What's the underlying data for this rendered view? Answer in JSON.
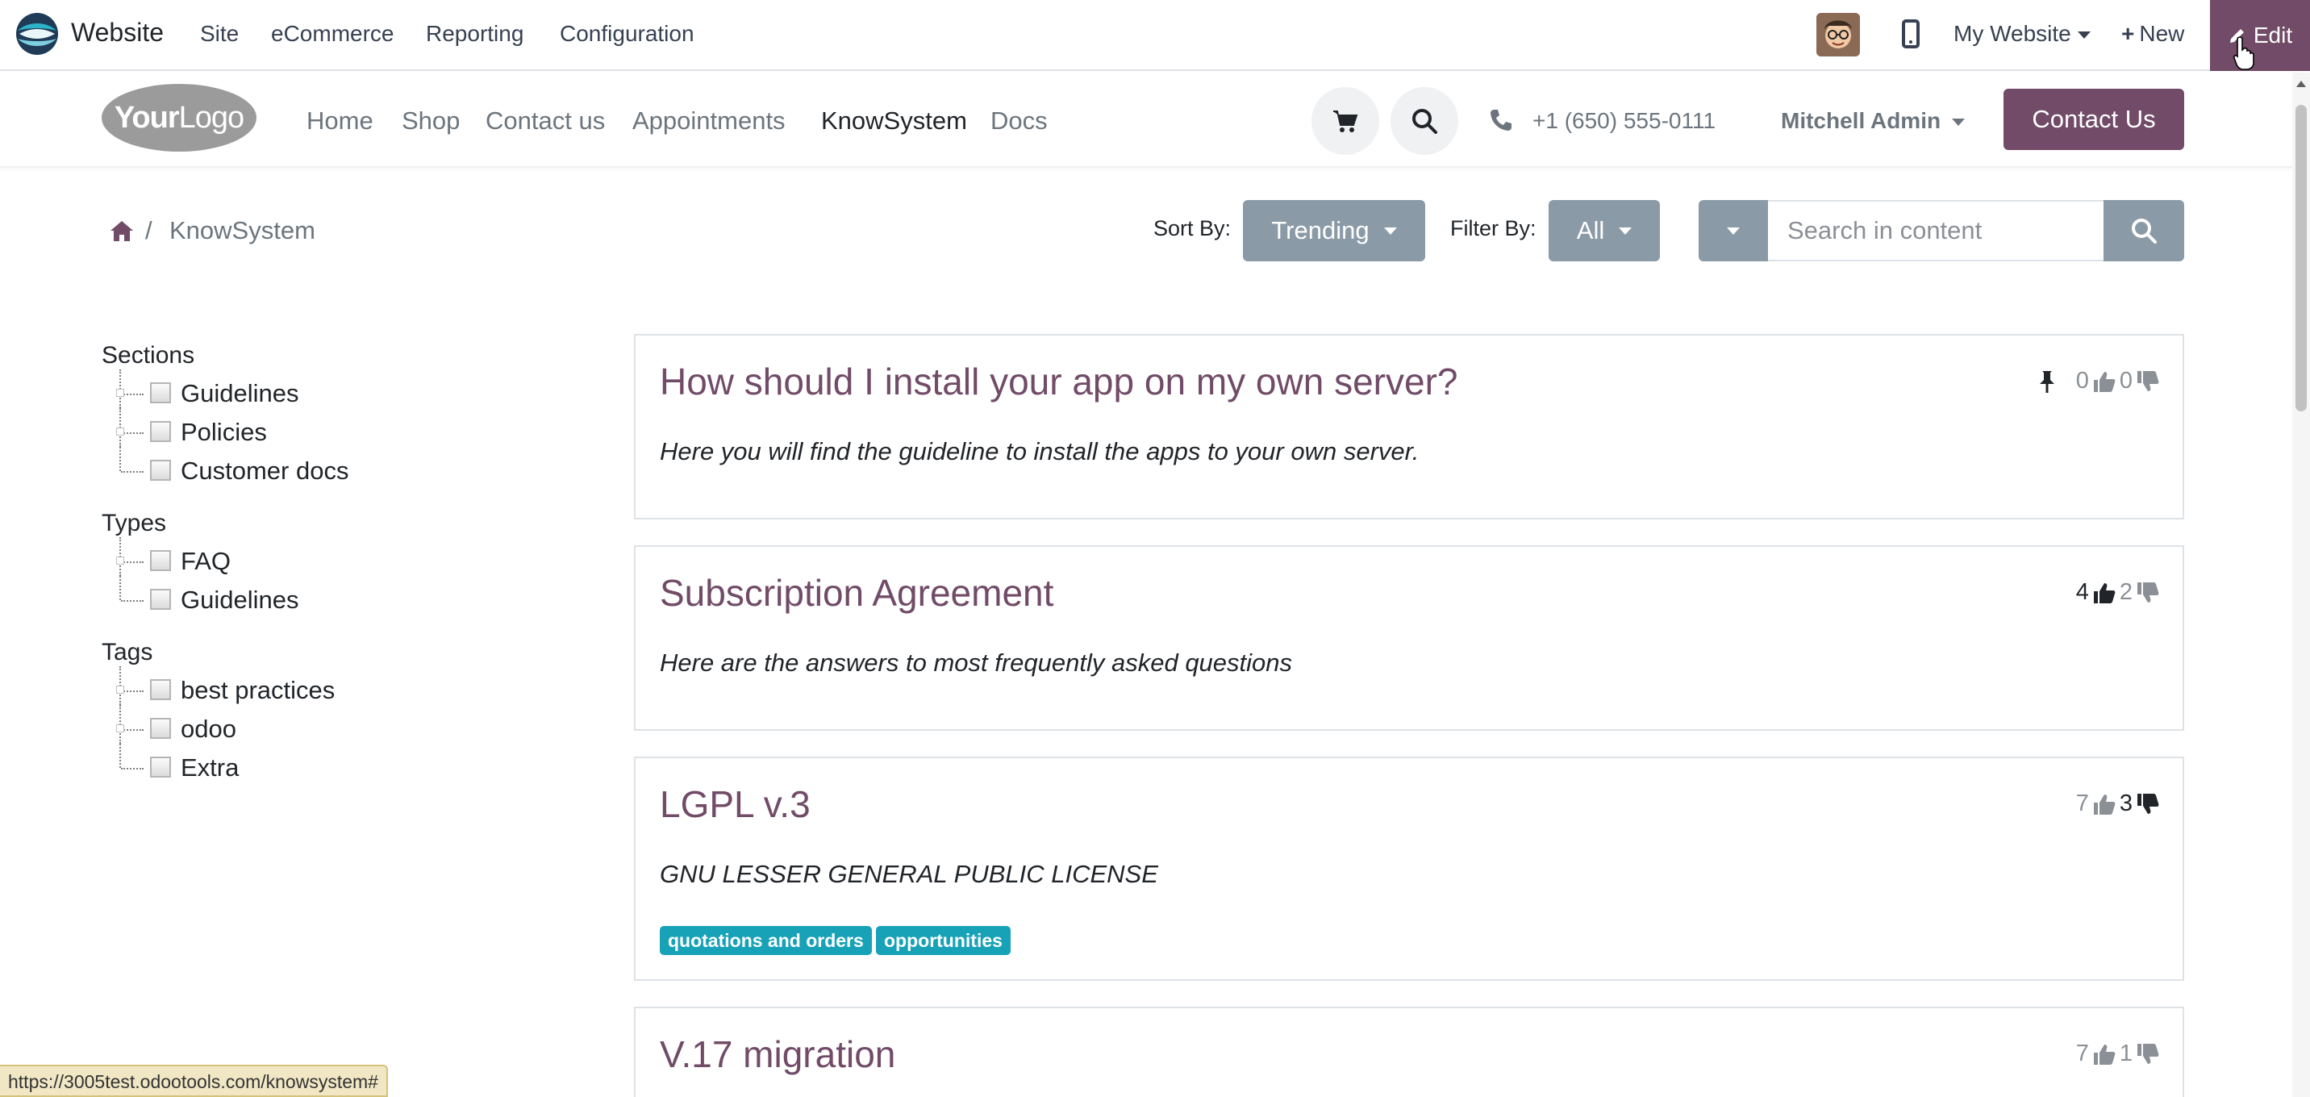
{
  "admin_bar": {
    "brand": "Website",
    "menus": [
      "Site",
      "eCommerce",
      "Reporting",
      "Configuration"
    ],
    "my_website": "My Website",
    "new_label": "New",
    "edit_label": "Edit",
    "accent": "#714b67"
  },
  "site_header": {
    "logo_bold": "Your",
    "logo_rest": "Logo",
    "nav": [
      "Home",
      "Shop",
      "Contact us",
      "Appointments",
      "KnowSystem",
      "Docs"
    ],
    "active_nav": "KnowSystem",
    "phone": "+1 (650) 555-0111",
    "user": "Mitchell Admin",
    "contact_btn": "Contact Us"
  },
  "toolbar": {
    "breadcrumb_current": "KnowSystem",
    "breadcrumb_sep": "/",
    "sort_label": "Sort By:",
    "sort_value": "Trending",
    "filter_label": "Filter By:",
    "filter_value": "All",
    "search_placeholder": "Search in content"
  },
  "filters": {
    "sections": {
      "title": "Sections",
      "items": [
        "Guidelines",
        "Policies",
        "Customer docs"
      ]
    },
    "types": {
      "title": "Types",
      "items": [
        "FAQ",
        "Guidelines"
      ]
    },
    "tags": {
      "title": "Tags",
      "items": [
        "best practices",
        "odoo",
        "Extra"
      ]
    }
  },
  "articles": [
    {
      "title": "How should I install your app on my own server?",
      "description": "Here you will find the guideline to install the apps to your own server.",
      "likes": "0",
      "dislikes": "0",
      "pinned": true,
      "tags": []
    },
    {
      "title": "Subscription Agreement",
      "description": "Here are the answers to most frequently asked questions",
      "likes": "4",
      "dislikes": "2",
      "pinned": false,
      "tags": []
    },
    {
      "title": "LGPL v.3",
      "description": "GNU LESSER GENERAL PUBLIC LICENSE",
      "likes": "7",
      "dislikes": "3",
      "pinned": false,
      "tags": [
        "quotations and orders",
        "opportunities"
      ]
    },
    {
      "title": "V.17 migration",
      "description": "",
      "likes": "7",
      "dislikes": "1",
      "pinned": false,
      "tags": []
    }
  ],
  "status_bar": {
    "url": "https://3005test.odootools.com/knowsystem#"
  },
  "colors": {
    "brand": "#714b67",
    "button_grey": "#8a9aa6",
    "tag": "#17a2b8"
  }
}
